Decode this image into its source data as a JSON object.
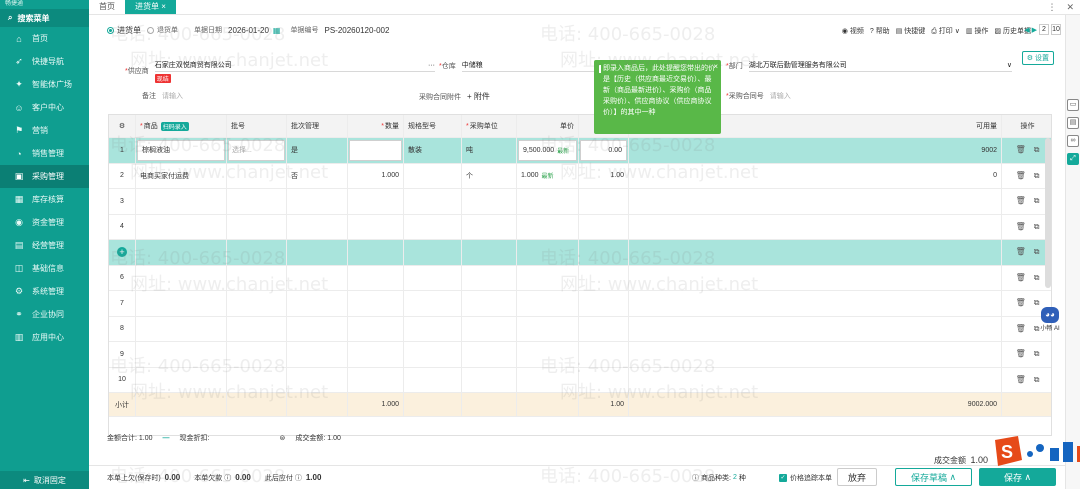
{
  "sidebar": {
    "brand": "畅捷通",
    "search_label": "搜索菜单",
    "items": [
      {
        "label": "首页",
        "icon": "home-icon"
      },
      {
        "label": "快捷导航",
        "icon": "rocket-icon"
      },
      {
        "label": "智能体广场",
        "icon": "ai-icon"
      },
      {
        "label": "客户中心",
        "icon": "customer-icon"
      },
      {
        "label": "营销",
        "icon": "marketing-icon"
      },
      {
        "label": "销售管理",
        "icon": "sales-icon"
      },
      {
        "label": "采购管理",
        "icon": "purchase-icon",
        "active": true
      },
      {
        "label": "库存核算",
        "icon": "inventory-icon"
      },
      {
        "label": "资金管理",
        "icon": "funds-icon"
      },
      {
        "label": "经营管理",
        "icon": "business-icon"
      },
      {
        "label": "基础信息",
        "icon": "base-info-icon"
      },
      {
        "label": "系统管理",
        "icon": "system-icon"
      },
      {
        "label": "企业协同",
        "icon": "collab-icon"
      },
      {
        "label": "应用中心",
        "icon": "apps-icon"
      }
    ],
    "footer": "取消固定"
  },
  "tabs": [
    {
      "label": "首页"
    },
    {
      "label": "进货单 ×",
      "active": true
    }
  ],
  "form": {
    "type_options": [
      "进货单",
      "退货单"
    ],
    "date_label": "单据日期",
    "date": "2026-01-20",
    "code_label": "单据编号",
    "code": "PS-20260120-002",
    "supplier_label": "供应商",
    "supplier": "石家庄双悦商贸有限公司",
    "supplier_tag": "现结",
    "warehouse_label": "仓库",
    "warehouse": "中储粮",
    "dept_label": "部门",
    "dept": "湖北万联后勤管理服务有限公司",
    "remark_label": "备注",
    "remark_placeholder": "请输入",
    "attach_label": "采购合同附件",
    "attach_btn": "+ 附件",
    "contract_label": "采购合同号",
    "contract_placeholder": "请输入",
    "settings_btn": "设置",
    "dots": "···"
  },
  "toolbar": {
    "items": [
      "视频",
      "帮助",
      "快捷键",
      "打印",
      "操作",
      "历史单据"
    ],
    "page": "2",
    "total": "10"
  },
  "tooltip": {
    "text": "即录入商品后，此处提醒您带出的价是【历史（供应商最近交易价）、最新（商品最新进价）、采购价（商品采购价）、供应商协议（供应商协议价）】的其中一种",
    "close": "×"
  },
  "table": {
    "headers": {
      "settings": "⚙",
      "product": "商品",
      "scan": "扫码录入",
      "batch": "批号",
      "batch_mgmt": "批次管理",
      "qty": "数量",
      "spec": "规格型号",
      "unit": "采购单位",
      "price": "单价",
      "amount": "金额",
      "avail": "可用量",
      "ops": "操作"
    },
    "rows": [
      {
        "no": "1",
        "product": "棕榈液油",
        "batch": "选择...",
        "batch_mgmt": "是",
        "qty": "",
        "spec": "散装",
        "unit": "吨",
        "price": "9,500.000",
        "price_tag": "最新",
        "amount": "0.00",
        "avail": "9002"
      },
      {
        "no": "2",
        "product": "电商买家付运费",
        "batch": "",
        "batch_mgmt": "否",
        "qty": "1.000",
        "spec": "",
        "unit": "个",
        "price": "1.000",
        "price_tag": "最新",
        "amount": "1.00",
        "avail": "0"
      },
      {
        "no": "3"
      },
      {
        "no": "4"
      },
      {
        "no": "+"
      },
      {
        "no": "6"
      },
      {
        "no": "7"
      },
      {
        "no": "8"
      },
      {
        "no": "9"
      },
      {
        "no": "10"
      }
    ],
    "total": {
      "label": "小计",
      "qty": "1.000",
      "amount": "1.00",
      "avail": "9002.000"
    }
  },
  "summary": {
    "amount_label": "金额合计:",
    "amount": "1.00",
    "discount_label": "现金折扣:",
    "deal_label": "成交金额:",
    "deal": "1.00"
  },
  "deal_right": {
    "label": "成交金额",
    "value": "1.00"
  },
  "footer": {
    "prev_owe_label": "本单上欠(保存时)",
    "prev_owe": "0.00",
    "this_owe_label": "本单欠款",
    "this_owe": "0.00",
    "pay_label": "此后应付",
    "pay": "1.00",
    "kinds_label": "商品种类:",
    "kinds": "2",
    "kinds_unit": "种",
    "trace_label": "价格追踪本单",
    "abandon": "放弃",
    "save_draft": "保存草稿",
    "save": "保存"
  },
  "ai": {
    "label": "小畅 AI"
  },
  "watermark": {
    "phone": "电话: 400-665-0028",
    "site": "网址: www.chanjet.net"
  }
}
